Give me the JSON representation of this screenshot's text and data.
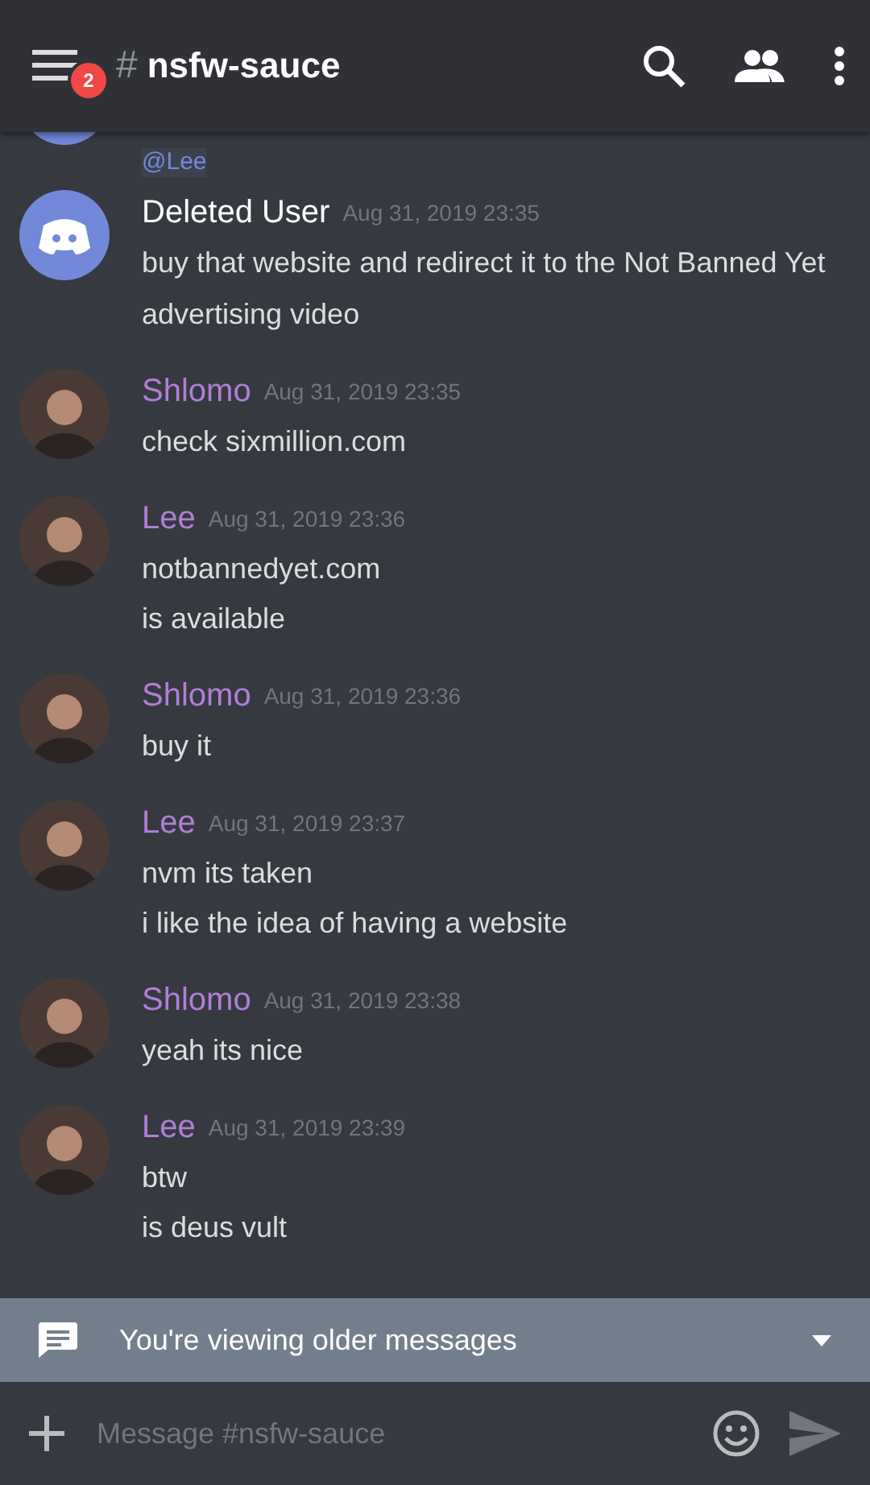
{
  "header": {
    "badge": "2",
    "hash": "#",
    "channel": "nsfw-sauce"
  },
  "cut_message": {
    "text": "@Lee"
  },
  "messages": [
    {
      "author": "Deleted User",
      "color": "#ffffff",
      "kind": "default",
      "time": "Aug 31, 2019 23:35",
      "lines": [
        "buy that website and redirect it to the Not Banned Yet advertising video"
      ]
    },
    {
      "author": "Shlomo",
      "color": "#b07ed8",
      "kind": "photo",
      "time": "Aug 31, 2019 23:35",
      "lines": [
        "check sixmillion.com"
      ]
    },
    {
      "author": "Lee",
      "color": "#b07ed8",
      "kind": "photo",
      "time": "Aug 31, 2019 23:36",
      "lines": [
        "notbannedyet.com",
        "is available"
      ]
    },
    {
      "author": "Shlomo",
      "color": "#b07ed8",
      "kind": "photo",
      "time": "Aug 31, 2019 23:36",
      "lines": [
        "buy it"
      ]
    },
    {
      "author": "Lee",
      "color": "#b07ed8",
      "kind": "photo",
      "time": "Aug 31, 2019 23:37",
      "lines": [
        "nvm its taken",
        "i like the idea of having a website"
      ]
    },
    {
      "author": "Shlomo",
      "color": "#b07ed8",
      "kind": "photo",
      "time": "Aug 31, 2019 23:38",
      "lines": [
        "yeah its nice"
      ]
    },
    {
      "author": "Lee",
      "color": "#b07ed8",
      "kind": "photo",
      "time": "Aug 31, 2019 23:39",
      "lines": [
        "btw",
        "is deus vult"
      ]
    }
  ],
  "banner": {
    "text": "You're viewing older messages"
  },
  "composer": {
    "placeholder": "Message #nsfw-sauce"
  }
}
